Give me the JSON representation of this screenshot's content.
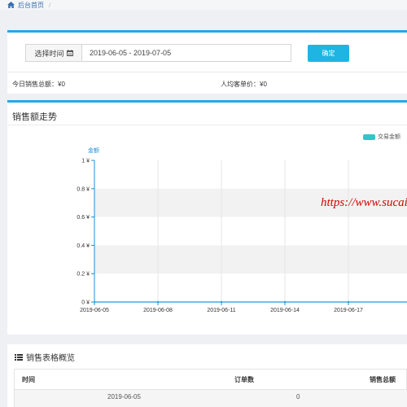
{
  "breadcrumb": {
    "home_label": "后台首页",
    "separator": "/"
  },
  "filter": {
    "date_label": "选择时间",
    "date_range": "2019-06-05 - 2019-07-05",
    "confirm_label": "确定",
    "today_sales": "今日销售总额：¥0",
    "avg_price": "人均客单价：¥0"
  },
  "chart_panel": {
    "title": "销售额走势",
    "watermark": "https://www.sucai"
  },
  "chart_data": {
    "type": "line",
    "ylabel": "金额",
    "ylim": [
      0,
      1
    ],
    "y_ticks": [
      "1 ¥",
      "0.8 ¥",
      "0.6 ¥",
      "0.4 ¥",
      "0.2 ¥",
      "0 ¥"
    ],
    "x_ticks": [
      "2019-06-05",
      "2019-06-08",
      "2019-06-11",
      "2019-06-14",
      "2019-06-17",
      "2"
    ],
    "series": [
      {
        "name": "交易金额",
        "color": "#2fc7c9",
        "values": [
          0,
          0,
          0,
          0,
          0,
          0
        ]
      }
    ],
    "grid": true,
    "legend": "top-right"
  },
  "table": {
    "title": "销售表格概览",
    "columns": [
      "时间",
      "订单数",
      "销售总额"
    ],
    "rows": [
      [
        "2019-06-05",
        "0",
        ""
      ]
    ]
  },
  "colors": {
    "accent": "#2aa6e0",
    "button": "#1fb5e3",
    "series": "#2fc7c9",
    "watermark": "#d80000"
  }
}
